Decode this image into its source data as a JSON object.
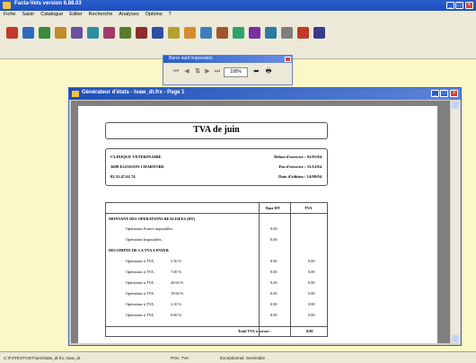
{
  "app": {
    "title": "Facta-Vets version 6.88.03",
    "menu": [
      "Fiche",
      "Saisir",
      "Catalogue",
      "Editer",
      "Recherche",
      "Analyses",
      "Options",
      "?"
    ]
  },
  "toolbar": {
    "icons": [
      {
        "name": "new-document-icon",
        "color": "#c0392b"
      },
      {
        "name": "edit-icon",
        "color": "#2e6bbd"
      },
      {
        "name": "client-icon",
        "color": "#3a8b3a"
      },
      {
        "name": "catalogue-icon",
        "color": "#c28b2c"
      },
      {
        "name": "search-icon",
        "color": "#6b4fa3"
      },
      {
        "name": "stock-icon",
        "color": "#2e8fa3"
      },
      {
        "name": "calendar-icon",
        "color": "#a33a6b"
      },
      {
        "name": "report-icon",
        "color": "#587c2e"
      },
      {
        "name": "print-icon",
        "color": "#8a2e2e"
      },
      {
        "name": "chart-icon",
        "color": "#2e4fa3"
      },
      {
        "name": "money-icon",
        "color": "#b5a12e"
      },
      {
        "name": "folder-icon",
        "color": "#d98a2e"
      },
      {
        "name": "invoice-icon",
        "color": "#3f7fbf"
      },
      {
        "name": "pets-icon",
        "color": "#a3542e"
      },
      {
        "name": "vaccine-icon",
        "color": "#2ea36b"
      },
      {
        "name": "mail-icon",
        "color": "#7a2ea3"
      },
      {
        "name": "phone-icon",
        "color": "#2e7aa3"
      },
      {
        "name": "settings-icon",
        "color": "#7f7f7f"
      },
      {
        "name": "help-icon",
        "color": "#c0392b"
      },
      {
        "name": "exit-icon",
        "color": "#3a3a8b"
      }
    ]
  },
  "palette": {
    "title": "Barre outil Impression",
    "zoom": "100%"
  },
  "document_window": {
    "title": "Générateur d'états - tvaw_dt.frx - Page 1"
  },
  "report": {
    "title": "TVA de juin",
    "clinic": [
      "CLINIQUE VETERINAIRE",
      "3609 EGOSSON CHARTORE",
      "02.31.47.62.74"
    ],
    "meta": [
      {
        "label": "Debut d'exercice :",
        "value": "01/01/04"
      },
      {
        "label": "Fin d'exercice :",
        "value": "31/12/04"
      },
      {
        "label": "Date d'édition :",
        "value": "14/09/04"
      }
    ],
    "headers": {
      "col1": "",
      "col2": "Base HT",
      "col3": "TVA"
    },
    "section1": "MONTANT DES OPERATIONS REALISEES (HT)",
    "section1_rows": [
      {
        "label": "Opérations France imposables",
        "base": "0.00",
        "tva": ""
      },
      {
        "label": "Opérations Imposables",
        "base": "0.00",
        "tva": ""
      }
    ],
    "section2": "DECOMPTE DE LA TVA A PAYER",
    "section2_rows": [
      {
        "label": "Opérations à TVA",
        "rate": "5.50 %",
        "base": "0.00",
        "tva": "0.00"
      },
      {
        "label": "Opérations à TVA",
        "rate": "7.00 %",
        "base": "0.00",
        "tva": "0.00"
      },
      {
        "label": "Opérations à TVA",
        "rate": "20.60 %",
        "base": "0.00",
        "tva": "0.00"
      },
      {
        "label": "Opérations à TVA",
        "rate": "19.60 %",
        "base": "0.00",
        "tva": "0.00"
      },
      {
        "label": "Opérations à TVA",
        "rate": "2.10 %",
        "base": "0.00",
        "tva": "0.00"
      },
      {
        "label": "Opérations à TVA",
        "rate": "0.00 %",
        "base": "0.00",
        "tva": "0.00"
      }
    ],
    "total_label": "Total TVA à verser :",
    "total_value": "0.00"
  },
  "statusbar": {
    "path": "C:\\Fv\\TEST\\VET\\ann\\stats_dt.frx, tvaw_dt",
    "code": "Prev. TVA",
    "message": "Exceptionnel: Genéralité"
  }
}
